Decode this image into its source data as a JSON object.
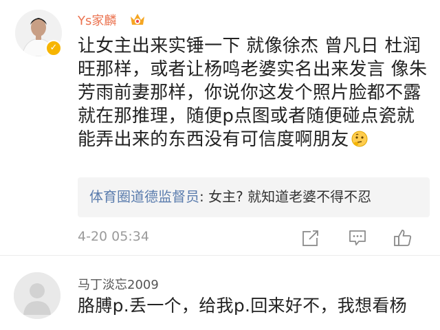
{
  "comments": [
    {
      "username": "Ys家麟",
      "text": "让女主出来实锤一下 就像徐杰 曾凡日 杜润旺那样，或者让杨鸣老婆实名出来发言 像朱芳雨前妻那样，你说你这发个照片脸都不露就在那推理，随便p点图或者随便碰点瓷就能弄出来的东西没有可信度啊朋友",
      "emoji": "thinking-face-emoji",
      "reply": {
        "author": "体育圈道德监督员",
        "separator": ": ",
        "text": "女主? 就知道老婆不得不忍"
      },
      "timestamp": "4-20 05:34",
      "actions": [
        "share-icon",
        "comment-icon",
        "like-icon"
      ],
      "username_color": "#eb7350"
    },
    {
      "username": "马丁淡忘2009",
      "text": "胳膊p.丢一个，给我p.回来好不，我想看杨"
    }
  ],
  "colors": {
    "link_blue": "#5a7cad",
    "timestamp_gray": "#9a9a9a",
    "reply_bg": "#f4f4f4",
    "verified_gold": "#f7b500"
  }
}
